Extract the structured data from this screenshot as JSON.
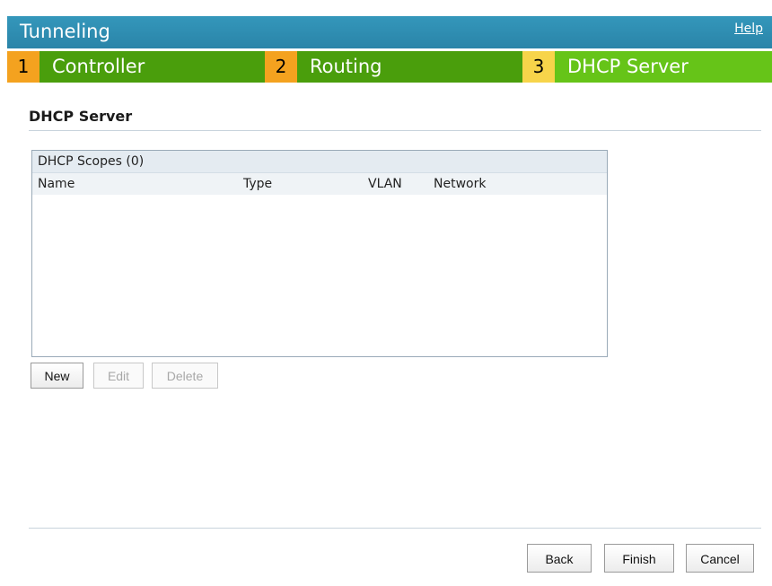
{
  "header": {
    "title": "Tunneling",
    "help_label": "Help"
  },
  "steps": [
    {
      "number": "1",
      "label": "Controller",
      "active": false
    },
    {
      "number": "2",
      "label": "Routing",
      "active": false
    },
    {
      "number": "3",
      "label": "DHCP Server",
      "active": true
    }
  ],
  "section": {
    "title": "DHCP Server"
  },
  "scopes_table": {
    "title": "DHCP Scopes (0)",
    "columns": [
      "Name",
      "Type",
      "VLAN",
      "Network"
    ],
    "rows": []
  },
  "table_actions": {
    "new_label": "New",
    "edit_label": "Edit",
    "delete_label": "Delete"
  },
  "footer": {
    "back_label": "Back",
    "finish_label": "Finish",
    "cancel_label": "Cancel"
  },
  "colors": {
    "title_bar": "#2e8baf",
    "step_number": "#f4a21f",
    "step_number_active": "#f7d44a",
    "step_bar": "#4a9e0c",
    "step_bar_active": "#66c418"
  }
}
